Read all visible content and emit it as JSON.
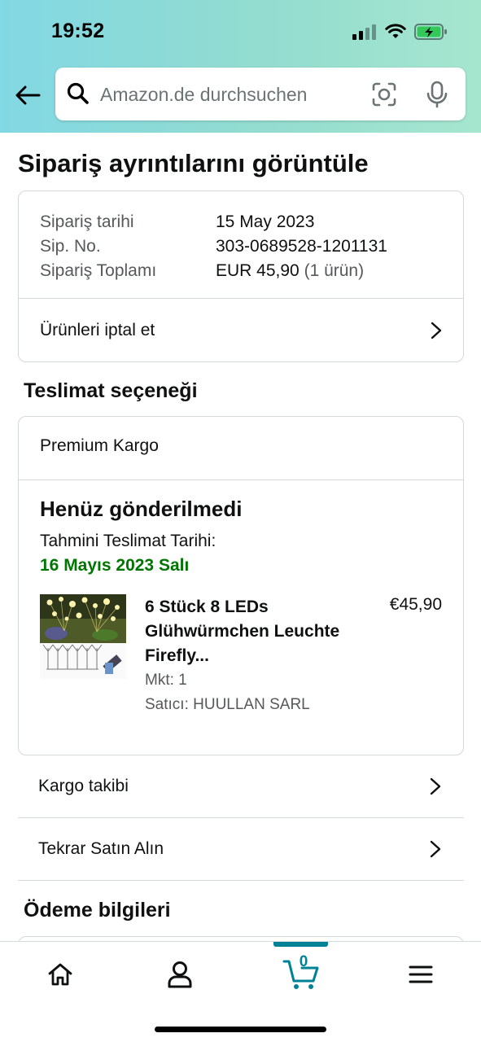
{
  "status_bar": {
    "time": "19:52"
  },
  "search": {
    "placeholder": "Amazon.de durchsuchen"
  },
  "page_title": "Sipariş ayrıntılarını görüntüle",
  "order_info": {
    "rows": [
      {
        "label": "Sipariş tarihi",
        "value": "15 May 2023"
      },
      {
        "label": "Sip. No.",
        "value": "303-0689528-1201131"
      },
      {
        "label": "Sipariş Toplamı",
        "value": "EUR 45,90",
        "extra": "(1 ürün)"
      }
    ],
    "cancel_label": "Ürünleri iptal et"
  },
  "delivery": {
    "section_title": "Teslimat seçeneği",
    "method": "Premium Kargo",
    "status": "Henüz gönderilmedi",
    "eta_label": "Tahmini Teslimat Tarihi:",
    "eta_date": "16 Mayıs 2023 Salı",
    "eta_color": "#007600",
    "product": {
      "title": "6 Stück 8 LEDs Glühwürmchen Leuchte Firefly...",
      "price": "€45,90",
      "qty": "Mkt: 1",
      "seller": "Satıcı: HUULLAN SARL"
    }
  },
  "links": {
    "track": "Kargo takibi",
    "rebuy": "Tekrar Satın Alın"
  },
  "payment": {
    "section_title": "Ödeme bilgileri"
  },
  "bottom_nav": {
    "items": [
      "home-icon",
      "account-icon",
      "cart-icon",
      "menu-icon"
    ],
    "cart_count": "0",
    "accent": "#008296"
  }
}
